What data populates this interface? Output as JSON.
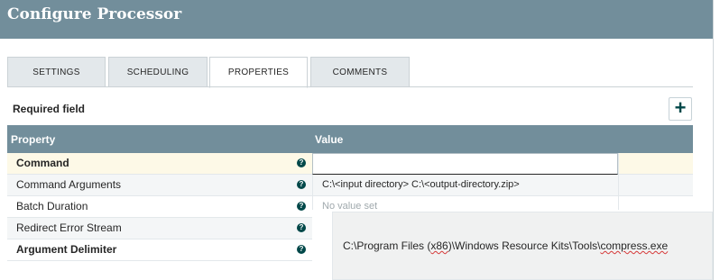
{
  "header": {
    "title": "Configure Processor"
  },
  "tabs": [
    {
      "label": "SETTINGS",
      "active": false
    },
    {
      "label": "SCHEDULING",
      "active": false
    },
    {
      "label": "PROPERTIES",
      "active": true
    },
    {
      "label": "COMMENTS",
      "active": false
    }
  ],
  "toolbar": {
    "required_label": "Required field",
    "add_icon": "plus-icon",
    "add_symbol": "+"
  },
  "table": {
    "columns": [
      "Property",
      "Value"
    ],
    "rows": [
      {
        "name": "Command",
        "bold": true,
        "value": "",
        "selected": true
      },
      {
        "name": "Command Arguments",
        "bold": false,
        "value": "C:\\<input directory> C:\\<output-directory.zip>"
      },
      {
        "name": "Batch Duration",
        "bold": false,
        "value": "No value set",
        "placeholder": true
      },
      {
        "name": "Redirect Error Stream",
        "bold": false,
        "value": ""
      },
      {
        "name": "Argument Delimiter",
        "bold": true,
        "value": ""
      }
    ],
    "help_symbol": "?"
  },
  "editor": {
    "value_prefix": "C:\\Program Files (",
    "value_x86": "x86",
    "value_mid": ")\\Windows Resource Kits\\Tools\\",
    "value_file": "compress.exe"
  },
  "colors": {
    "header": "#728e9b",
    "accent": "#004849",
    "selected_row": "#fdf9e7"
  }
}
